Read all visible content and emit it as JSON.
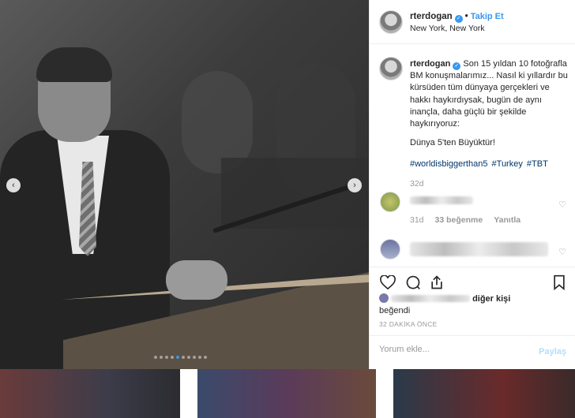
{
  "post": {
    "username": "rterdogan",
    "follow_label": "Takip Et",
    "location": "New York, New York",
    "caption": {
      "username": "rterdogan",
      "text": "Son 15 yıldan 10 fotoğrafla BM konuşmalarımız... Nasıl ki yıllardır bu kürsüden tüm dünyaya gerçekleri ve hakkı haykırdıysak, bugün de aynı inançla, daha güçlü bir şekilde haykırıyoruz:",
      "line2": "Dünya 5'ten Büyüktür!",
      "hashtags": [
        "#worldisbiggerthan5",
        "#Turkey",
        "#TBT"
      ],
      "time": "32d"
    },
    "comments": [
      {
        "time": "31d",
        "likes": "33 beğenme",
        "reply": "Yanıtla"
      }
    ],
    "likes": {
      "suffix": "diğer kişi",
      "line2": "beğendi"
    },
    "post_time": "32 DAKİKA ÖNCE",
    "comment_input_placeholder": "Yorum ekle...",
    "post_button": "Paylaş"
  },
  "icons": {
    "verified": "verified-badge-icon",
    "like": "heart-icon",
    "comment": "comment-bubble-icon",
    "share": "share-icon",
    "save": "bookmark-icon"
  },
  "colors": {
    "accent": "#3897f0",
    "hashtag": "#003569",
    "muted": "#999999"
  },
  "carousel": {
    "slide_count": 10,
    "active_index": 4
  }
}
